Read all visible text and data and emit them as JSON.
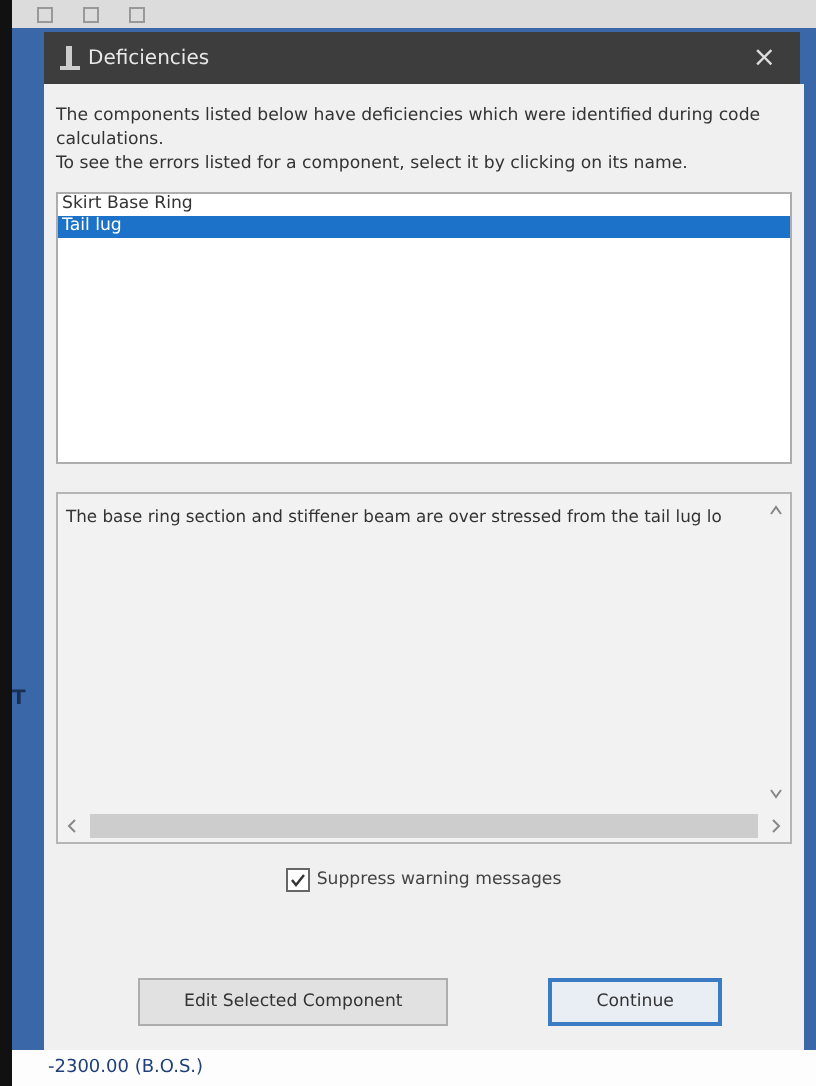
{
  "background": {
    "partial_label": "T",
    "status_value": "-2300.00 (B.O.S.)"
  },
  "dialog": {
    "title": "Deficiencies",
    "close": "×",
    "intro": [
      "The components listed below have deficiencies which were identified during code calculations.",
      "To see the errors listed for a component, select it by clicking on its name."
    ],
    "components": [
      {
        "name": "Skirt Base Ring",
        "selected": false
      },
      {
        "name": "Tail lug",
        "selected": true
      }
    ],
    "details": "The base ring section and stiffener beam are over stressed from the tail lug lo",
    "suppress_warnings": {
      "label": "Suppress warning messages",
      "checked": true
    },
    "buttons": [
      {
        "label": "Edit Selected Component",
        "default": false
      },
      {
        "label": "Continue",
        "default": true
      }
    ]
  }
}
